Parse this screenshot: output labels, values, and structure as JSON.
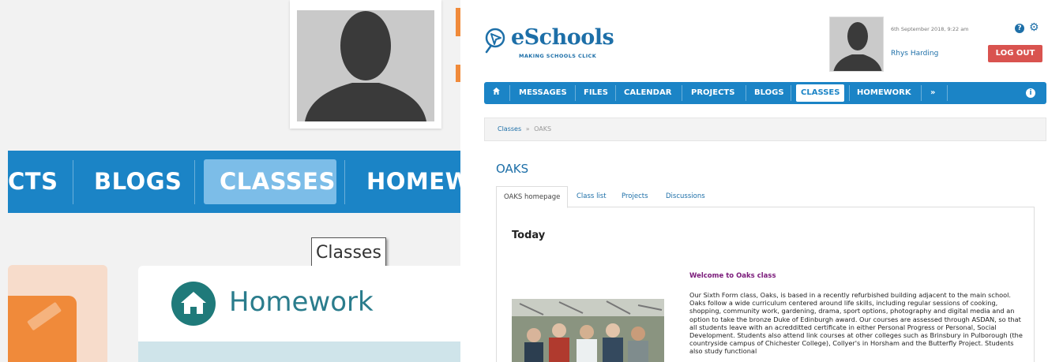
{
  "zoom": {
    "nav_items": [
      "CTS",
      "BLOGS",
      "CLASSES",
      "HOMEW"
    ],
    "tooltip": "Classes",
    "homework_label": "Homework"
  },
  "header": {
    "logo_title": "eSchools",
    "logo_tagline": "MAKING SCHOOLS CLICK",
    "datetime": "6th September 2018, 9:22 am",
    "username": "Rhys Harding",
    "logout_label": "LOG OUT",
    "help_icon": "question-circle-icon",
    "settings_icon": "gear-icon"
  },
  "nav": {
    "home_icon": "home-icon",
    "items": [
      "MESSAGES",
      "FILES",
      "CALENDAR",
      "PROJECTS",
      "BLOGS",
      "CLASSES",
      "HOMEWORK",
      "»"
    ],
    "active": "CLASSES",
    "info_icon": "info-icon"
  },
  "breadcrumb": {
    "root": "Classes",
    "separator": "»",
    "current": "OAKS"
  },
  "page": {
    "title": "OAKS",
    "tabs": [
      "OAKS homepage",
      "Class list",
      "Projects",
      "Discussions"
    ],
    "active_tab": "OAKS homepage",
    "section_heading": "Today",
    "post_title": "Welcome to Oaks class",
    "post_body": "Our Sixth Form class, Oaks, is based in a recently refurbished building adjacent to the main school. Oaks follow a wide curriculum centered around life skills, including regular sessions of cooking, shopping, community work, gardening, drama, sport options, photography and digital media and an option to take the bronze Duke of Edinburgh award. Our courses are assessed through ASDAN, so that all students leave with an acredditted certificate in either Personal Progress or Personal, Social Development. Students also attend link courses at other colleges such as Brinsbury in Pulborough (the countryside campus of Chichester College), Collyer's in Horsham and the Butterfly Project. Students also study functional"
  },
  "colors": {
    "nav_blue": "#1b84c6",
    "brand_blue": "#1d6fa8",
    "logout_red": "#d9534f",
    "post_title_purple": "#7a1a7a",
    "accent_orange": "#f08a3a"
  }
}
